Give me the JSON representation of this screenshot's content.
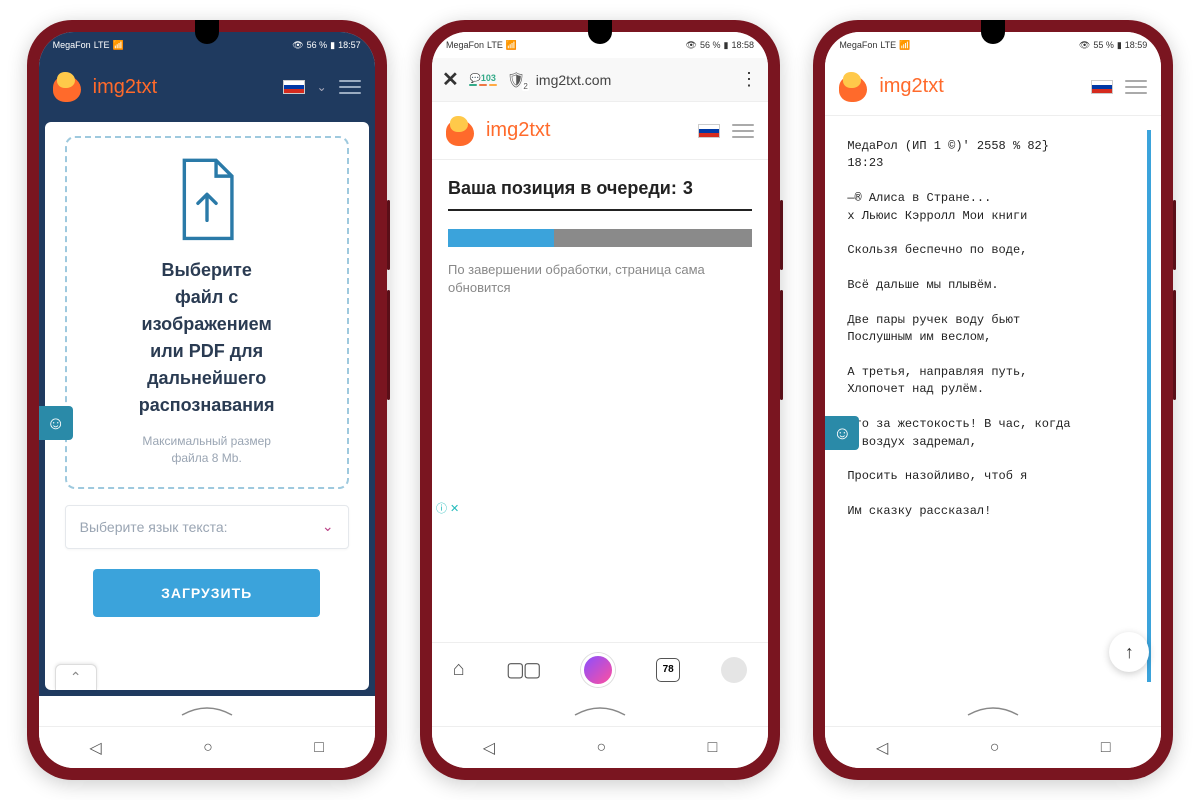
{
  "status": {
    "carrier": "MegaFon",
    "signal": "4G+",
    "p1": {
      "battery": "56 %",
      "time": "18:57"
    },
    "p2": {
      "battery": "56 %",
      "time": "18:58"
    },
    "p3": {
      "battery": "55 %",
      "time": "18:59"
    }
  },
  "brand": "img2txt",
  "phone1": {
    "upload_lines": "Выберите\nфайл с\nизображением\nили PDF для\nдальнейшего\nраспознавания",
    "max_size": "Максимальный размер\nфайла 8 Mb.",
    "lang_placeholder": "Выберите язык текста:",
    "button": "ЗАГРУЗИТЬ"
  },
  "phone2": {
    "comments_count": "103",
    "shield_badge": "2",
    "url": "img2txt.com",
    "queue_label": "Ваша позиция в очереди:",
    "queue_pos": "3",
    "progress_pct": 35,
    "note": "По завершении обработки, страница сама обновится",
    "tabs_count": "78"
  },
  "phone3": {
    "result_text": "МедаРол (ИП 1 ©)' 2558 % 82}\n18:23\n\n—® Алиса в Стране...\nх Льюис Кэрролл Мои книги\n\nСкользя беспечно по воде,\n\nВсё дальше мы плывём.\n\nДве пары ручек воду бьют\nПослушным им веслом,\n\nА третья, направляя путь,\nХлопочет над рулём.\n\nЧто за жестокость! В час, когда\nИ воздух задремал,\n\nПросить назойливо, чтоб я\n\nИм сказку рассказал!"
  }
}
